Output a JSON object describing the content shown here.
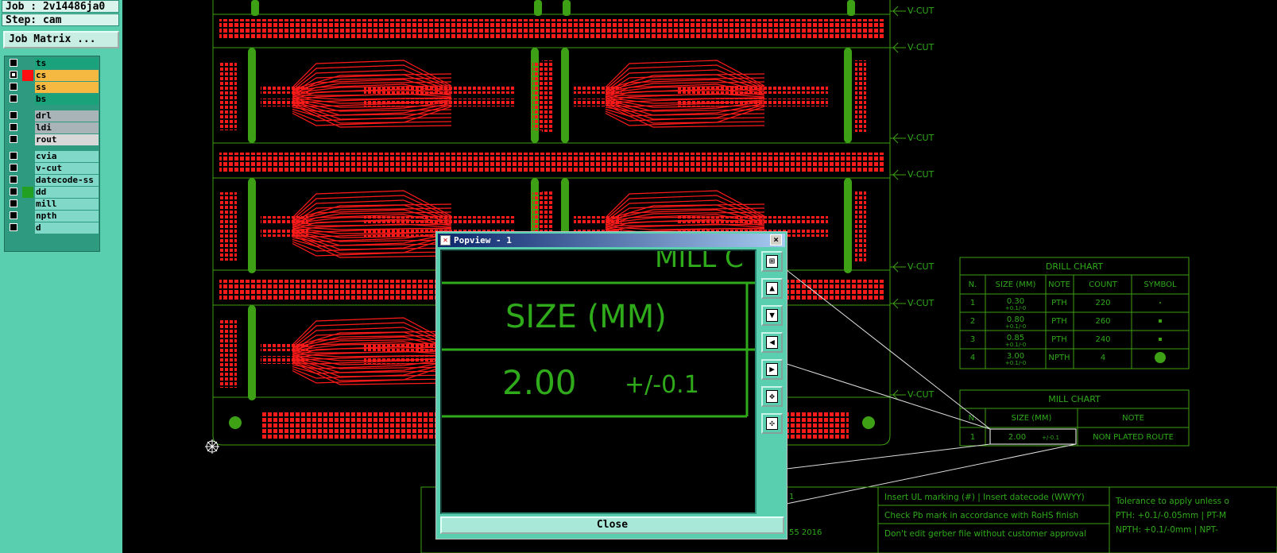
{
  "sidebar": {
    "job_label": "Job : 2v14486ja0",
    "step_label": "Step: cam",
    "job_matrix_button": "Job Matrix ...",
    "layers": [
      {
        "name": "ts",
        "color": "#1aa37a",
        "swatch": "",
        "checked": false
      },
      {
        "name": "cs",
        "color": "#f5b942",
        "swatch": "#ff1010",
        "checked": true
      },
      {
        "name": "ss",
        "color": "#f5b942",
        "swatch": "",
        "checked": false
      },
      {
        "name": "bs",
        "color": "#1aa37a",
        "swatch": "",
        "checked": false
      },
      {
        "name": "drl",
        "color": "#a8b4b8",
        "swatch": "",
        "checked": false
      },
      {
        "name": "ldi",
        "color": "#a8b4b8",
        "swatch": "",
        "checked": false
      },
      {
        "name": "rout",
        "color": "#d8d8d8",
        "swatch": "",
        "checked": false
      },
      {
        "name": "cvia",
        "color": "#7fd8c8",
        "swatch": "",
        "checked": false
      },
      {
        "name": "v-cut",
        "color": "#7fd8c8",
        "swatch": "",
        "checked": false
      },
      {
        "name": "datecode-ss",
        "color": "#7fd8c8",
        "swatch": "",
        "checked": false
      },
      {
        "name": "dd",
        "color": "#7fd8c8",
        "swatch": "#22a022",
        "checked": false
      },
      {
        "name": "mill",
        "color": "#7fd8c8",
        "swatch": "",
        "checked": false
      },
      {
        "name": "npth",
        "color": "#7fd8c8",
        "swatch": "",
        "checked": false
      },
      {
        "name": "d",
        "color": "#7fd8c8",
        "swatch": "",
        "checked": false
      }
    ]
  },
  "canvas": {
    "vcut_label": "V-CUT",
    "drill_chart": {
      "title": "DRILL CHART",
      "headers": [
        "N.",
        "SIZE (MM)",
        "NOTE",
        "COUNT",
        "SYMBOL"
      ],
      "rows": [
        {
          "n": "1",
          "size": "0.30",
          "tol": "+0.1/-0",
          "note": "PTH",
          "count": "220",
          "symbol": "dot-small"
        },
        {
          "n": "2",
          "size": "0.80",
          "tol": "+0.1/-0",
          "note": "PTH",
          "count": "260",
          "symbol": "square-small"
        },
        {
          "n": "3",
          "size": "0.85",
          "tol": "+0.1/-0",
          "note": "PTH",
          "count": "240",
          "symbol": "square-small"
        },
        {
          "n": "4",
          "size": "3.00",
          "tol": "+0.1/-0",
          "note": "NPTH",
          "count": "4",
          "symbol": "circle-large"
        }
      ]
    },
    "mill_chart": {
      "title": "MILL CHART",
      "headers": [
        "N.",
        "SIZE (MM)",
        "NOTE"
      ],
      "rows": [
        {
          "n": "1",
          "size": "2.00",
          "tol": "+/-0.1",
          "note": "NON PLATED ROUTE"
        }
      ]
    },
    "notes": [
      "Insert UL marking (#) | Insert datecode (WWYY)",
      "Check Pb mark in accordance with RoHS finish",
      "Don't edit gerber file without customer approval"
    ],
    "tolerance": [
      "Tolerance to apply unless o",
      "PTH: +0.1/-0.05mm | PT-M",
      "NPTH: +0.1/-0mm | NPT-"
    ],
    "fragment_1": "1",
    "fragment_year": "55 2016"
  },
  "popup": {
    "title": "Popview - 1",
    "view_top_text": "MILL C",
    "view_header": "SIZE (MM)",
    "view_value": "2.00",
    "view_tol": "+/-0.1",
    "close_label": "Close",
    "tools": [
      "zoom-window-icon",
      "zoom-in-icon",
      "zoom-out-icon",
      "pan-left-icon",
      "pan-right-icon",
      "fit-view-icon",
      "pan-all-icon"
    ]
  }
}
